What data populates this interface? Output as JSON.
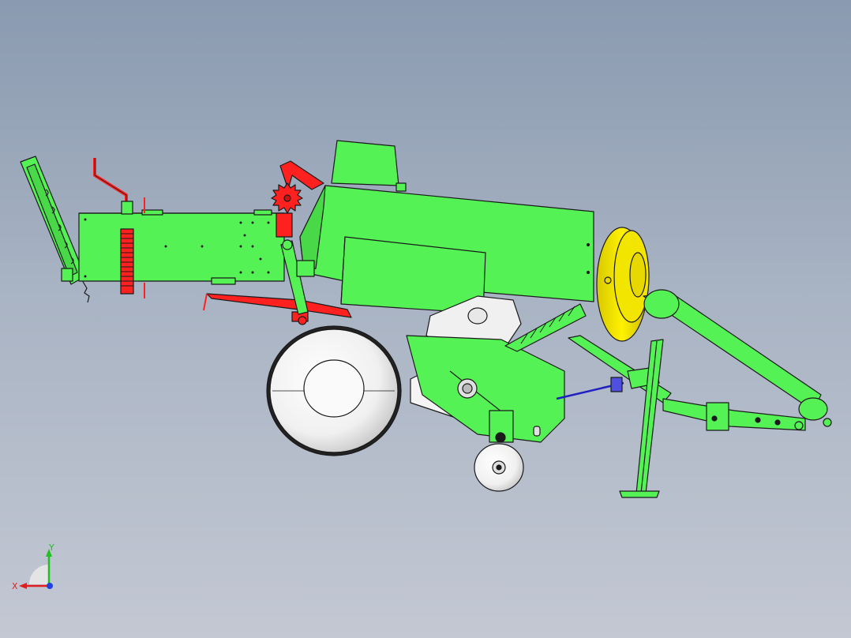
{
  "viewport": {
    "background_top": "#8a9ab0",
    "background_bottom": "#c3c8d3"
  },
  "model": {
    "colors": {
      "frame_green": "#55f255",
      "mechanism_red": "#ff2020",
      "flywheel_yellow": "#f2e600",
      "wheel_white": "#f4f4f4",
      "link_blue": "#2020c0",
      "outline": "#1a1a1a"
    }
  },
  "triad": {
    "x_label": "X",
    "y_label": "Y",
    "x_color": "#e02020",
    "y_color": "#20c020",
    "z_color": "#2040e0"
  }
}
